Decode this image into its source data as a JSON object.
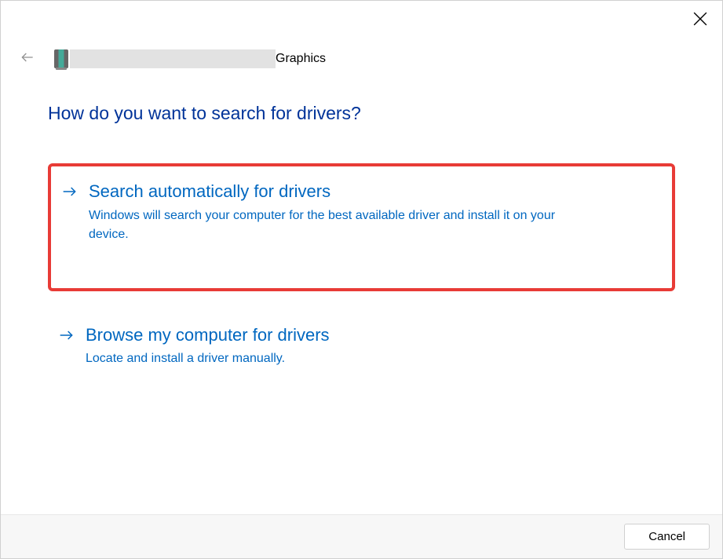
{
  "header": {
    "device_suffix": "Graphics"
  },
  "page_title": "How do you want to search for drivers?",
  "options": [
    {
      "title": "Search automatically for drivers",
      "description": "Windows will search your computer for the best available driver and install it on your device."
    },
    {
      "title": "Browse my computer for drivers",
      "description": "Locate and install a driver manually."
    }
  ],
  "footer": {
    "cancel_label": "Cancel"
  }
}
